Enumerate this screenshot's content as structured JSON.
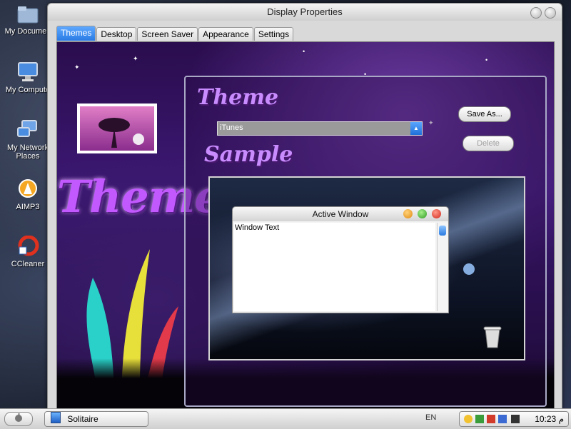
{
  "desktop": {
    "icons": [
      {
        "label": "My Documen"
      },
      {
        "label": "My Compute"
      },
      {
        "label": "My Network",
        "label2": "Places"
      },
      {
        "label": "AIMP3"
      },
      {
        "label": "CCleaner"
      }
    ]
  },
  "window": {
    "title": "Display Properties",
    "tabs": [
      "Themes",
      "Desktop",
      "Screen Saver",
      "Appearance",
      "Settings"
    ],
    "active_tab": "Themes",
    "banner_text": "Themes",
    "theme_heading": "Theme",
    "sample_heading": "Sample",
    "theme_select": {
      "value": "iTunes"
    },
    "save_as_label": "Save As...",
    "delete_label": "Delete",
    "preview": {
      "title": "Active Window",
      "body_text": "Window Text"
    }
  },
  "taskbar": {
    "task_label": "Solitaire",
    "language": "EN",
    "clock": "10:23 م"
  },
  "colors": {
    "accent_tab": "#2a7be4",
    "heading": "#c98cff"
  }
}
